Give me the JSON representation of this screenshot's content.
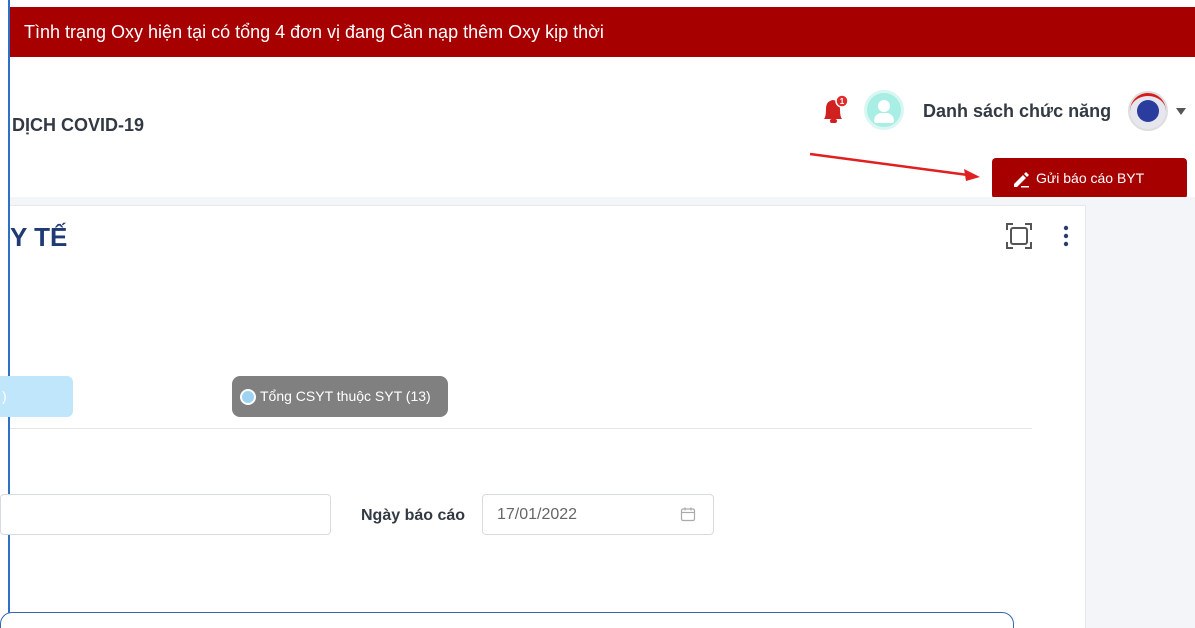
{
  "banner": {
    "text": "Tình trạng Oxy hiện tại có tổng 4 đơn vị đang Cần nạp thêm Oxy kịp thời"
  },
  "header": {
    "title": "DỊCH COVID-19",
    "notification_count": "1",
    "menu_label": "Danh sách chức năng"
  },
  "actions": {
    "report_button_label": "Gửi báo cáo BYT"
  },
  "card": {
    "title": "Y TẾ",
    "tabs": [
      {
        "label": ")"
      },
      {
        "label": "Tổng CSYT thuộc SYT (13)"
      }
    ],
    "report_date_label": "Ngày báo cáo",
    "report_date_value": "17/01/2022"
  },
  "colors": {
    "brand_red": "#a60000",
    "title_blue": "#1f3a74",
    "tab_active_light": "#bfe6fb",
    "tab_gray": "#808080"
  },
  "icons": [
    "bell-icon",
    "user-avatar-icon",
    "ministry-logo-icon",
    "chevron-down-icon",
    "pen-icon",
    "fullscreen-icon",
    "more-vertical-icon",
    "calendar-icon",
    "radio-dot-icon"
  ]
}
